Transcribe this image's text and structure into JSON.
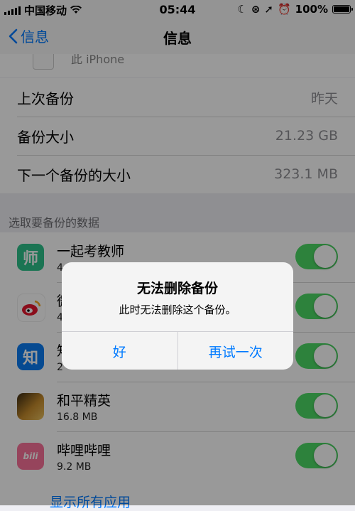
{
  "status": {
    "carrier": "中国移动",
    "time": "05:44",
    "battery": "100%"
  },
  "nav": {
    "back_label": "信息",
    "title": "信息"
  },
  "device": {
    "label": "此 iPhone"
  },
  "info_rows": [
    {
      "label": "上次备份",
      "value": "昨天"
    },
    {
      "label": "备份大小",
      "value": "21.23 GB"
    },
    {
      "label": "下一个备份的大小",
      "value": "323.1 MB"
    }
  ],
  "section_header": "选取要备份的数据",
  "apps": [
    {
      "name": "一起考教师",
      "size": "4",
      "icon_char": "师",
      "icon_color": "#2ec28a",
      "toggle_on": true
    },
    {
      "name": "微",
      "size": "4",
      "icon_char": "",
      "icon_color": "#f5a623",
      "toggle_on": true
    },
    {
      "name": "知",
      "size": "2",
      "icon_char": "知",
      "icon_color": "#0a7cf2",
      "toggle_on": true
    },
    {
      "name": "和平精英",
      "size": "16.8 MB",
      "icon_char": "",
      "icon_color": "#c58a2b",
      "toggle_on": true
    },
    {
      "name": "哔哩哔哩",
      "size": "9.2 MB",
      "icon_char": "bili",
      "icon_color": "#fb7299",
      "toggle_on": true
    }
  ],
  "show_all_label": "显示所有应用",
  "alert": {
    "title": "无法删除备份",
    "message": "此时无法删除这个备份。",
    "ok_label": "好",
    "retry_label": "再试一次"
  },
  "colors": {
    "accent": "#007aff",
    "toggle_on": "#4cd964"
  }
}
